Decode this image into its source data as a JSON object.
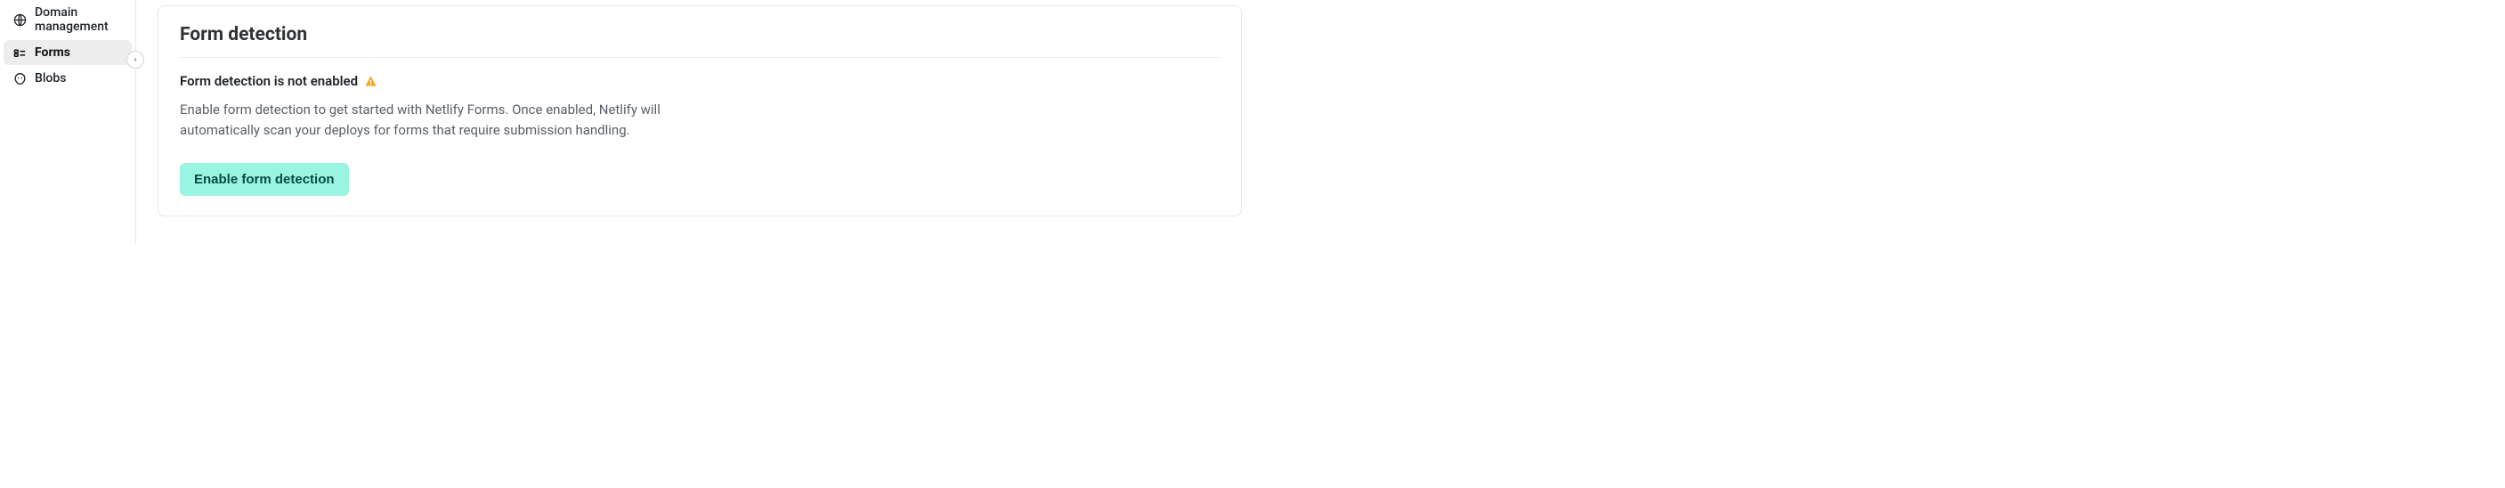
{
  "sidebar": {
    "items": [
      {
        "label": "Domain management",
        "icon": "globe-icon",
        "active": false
      },
      {
        "label": "Forms",
        "icon": "form-icon",
        "active": true
      },
      {
        "label": "Blobs",
        "icon": "blob-icon",
        "active": false
      }
    ]
  },
  "collapse": {
    "chevron": "‹"
  },
  "card": {
    "title": "Form detection",
    "status": "Form detection is not enabled",
    "description": "Enable form detection to get started with Netlify Forms. Once enabled, Netlify will automatically scan your deploys for forms that require submission handling.",
    "enable_label": "Enable form detection"
  }
}
